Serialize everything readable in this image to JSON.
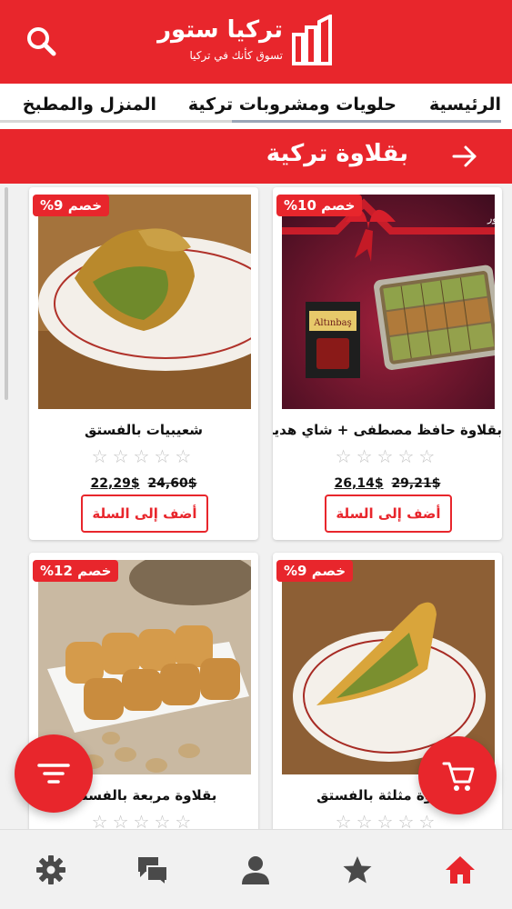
{
  "header": {
    "logo_title": "تركيا ستور",
    "logo_tagline": "تسوق كأنك في تركيا",
    "search_icon": "search-icon",
    "brand_color": "#e8262c"
  },
  "categories": [
    {
      "label": "الرئيسية"
    },
    {
      "label": "حلويات ومشروبات تركية"
    },
    {
      "label": "المنزل والمطبخ"
    }
  ],
  "section": {
    "title": "بقلاوة تركية",
    "back_icon": "arrow-right-icon"
  },
  "products": [
    {
      "name": "بقلاوة حافظ مصطفى + شاي هدية",
      "discount": "خصم 10%",
      "price_old": "29,21$",
      "price_new": "26,14$",
      "rating": 0,
      "cart_label": "أضف إلى السلة",
      "image_caption": "هدية تركيا ستور",
      "image_product_text": "Altınbaş"
    },
    {
      "name": "شعيبيات بالفستق",
      "discount": "خصم 9%",
      "price_old": "24,60$",
      "price_new": "22,29$",
      "rating": 0,
      "cart_label": "أضف إلى السلة"
    },
    {
      "name": "بقلاوة مثلثة بالفستق",
      "discount": "خصم 9%",
      "rating": 0
    },
    {
      "name": "بقلاوة مربعة بالفستق",
      "discount": "خصم 12%",
      "rating": 0
    }
  ],
  "stars_text": "☆☆☆☆☆",
  "fabs": {
    "filter_icon": "filter-icon",
    "cart_icon": "cart-icon"
  },
  "bottom_nav": [
    {
      "icon": "gear-icon"
    },
    {
      "icon": "chat-icon"
    },
    {
      "icon": "user-icon"
    },
    {
      "icon": "star-icon"
    },
    {
      "icon": "home-icon",
      "active": true
    }
  ]
}
